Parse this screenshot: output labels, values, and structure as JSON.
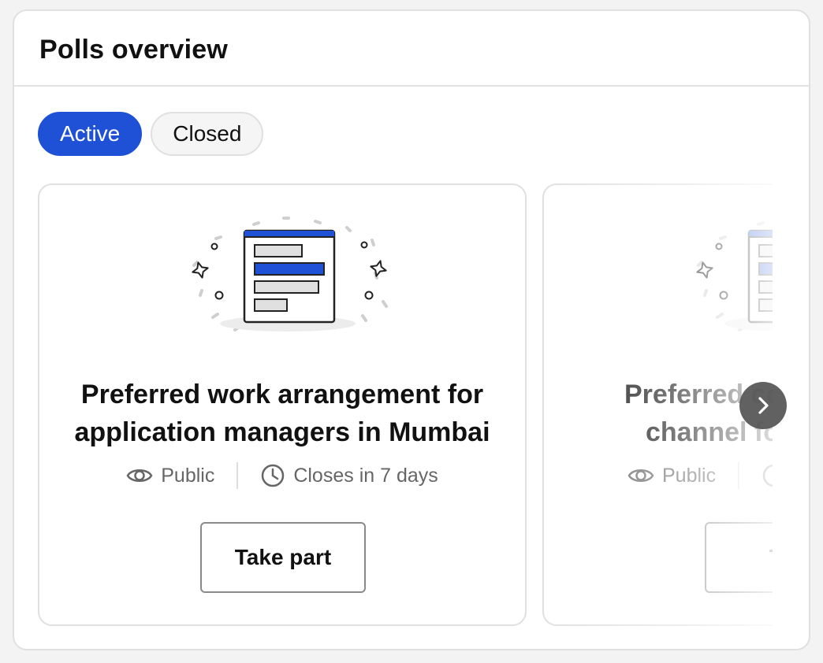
{
  "header": {
    "title": "Polls overview"
  },
  "tabs": [
    {
      "label": "Active",
      "selected": true
    },
    {
      "label": "Closed",
      "selected": false
    }
  ],
  "cards": [
    {
      "title_line1": "Preferred work arrangement for",
      "title_line2": "application managers in Mumbai",
      "visibility": "Public",
      "closes": "Closes in 7 days",
      "button": "Take part"
    },
    {
      "title_line1": "Preferred co",
      "title_line2": "channel fo",
      "visibility": "Public",
      "closes": "",
      "button": "Tak"
    }
  ],
  "icons": {
    "visibility": "eye-icon",
    "closes": "clock-icon",
    "next": "chevron-right-icon"
  },
  "colors": {
    "accent": "#1f51d6",
    "poll_bar_grey": "#e0e0e0"
  }
}
